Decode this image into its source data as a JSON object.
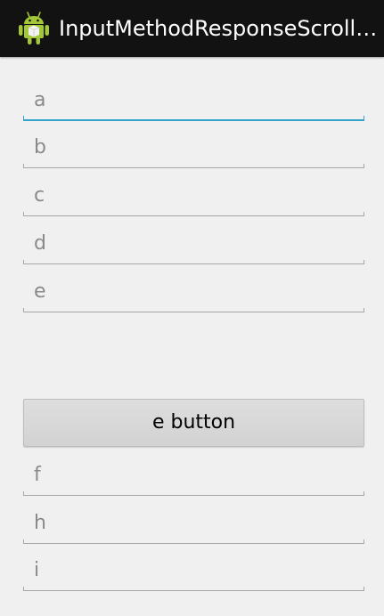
{
  "app_bar": {
    "title": "InputMethodResponseScrollVi…",
    "icon": "android-robot-icon",
    "background": "#121212"
  },
  "fields": {
    "a": {
      "placeholder": "a",
      "value": ""
    },
    "b": {
      "placeholder": "b",
      "value": ""
    },
    "c": {
      "placeholder": "c",
      "value": ""
    },
    "d": {
      "placeholder": "d",
      "value": ""
    },
    "e": {
      "placeholder": "e",
      "value": ""
    },
    "f": {
      "placeholder": "f",
      "value": ""
    },
    "h": {
      "placeholder": "h",
      "value": ""
    },
    "i": {
      "placeholder": "i",
      "value": ""
    }
  },
  "e_button": {
    "label": "e button"
  },
  "colors": {
    "focus_accent": "#33a3c9",
    "underline": "#a6a6a6",
    "hint_text": "#8a8a8a",
    "background": "#f0f0f0"
  }
}
